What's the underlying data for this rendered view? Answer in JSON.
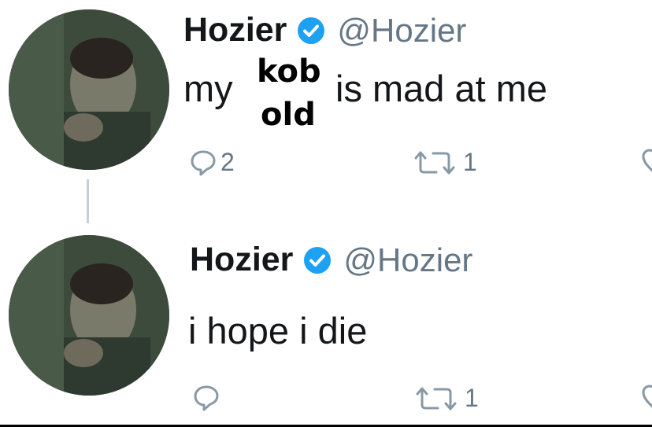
{
  "colors": {
    "name": "#14171a",
    "handle": "#657786",
    "verified": "#1da1f2",
    "icon": "#8899a6"
  },
  "tweets": [
    {
      "name": "Hozier",
      "handle": "@Hozier",
      "text_before": "my",
      "text_after": "is mad at me",
      "overlay_words": [
        "kob",
        "old"
      ],
      "reply_count": "2",
      "retweet_count": "1",
      "icons": [
        "avatar",
        "verified-badge-icon",
        "reply-icon",
        "retweet-icon",
        "like-icon"
      ]
    },
    {
      "name": "Hozier",
      "handle": "@Hozier",
      "text": "i hope i die",
      "reply_count": "",
      "retweet_count": "1",
      "icons": [
        "avatar",
        "verified-badge-icon",
        "reply-icon",
        "retweet-icon",
        "like-icon"
      ]
    }
  ]
}
